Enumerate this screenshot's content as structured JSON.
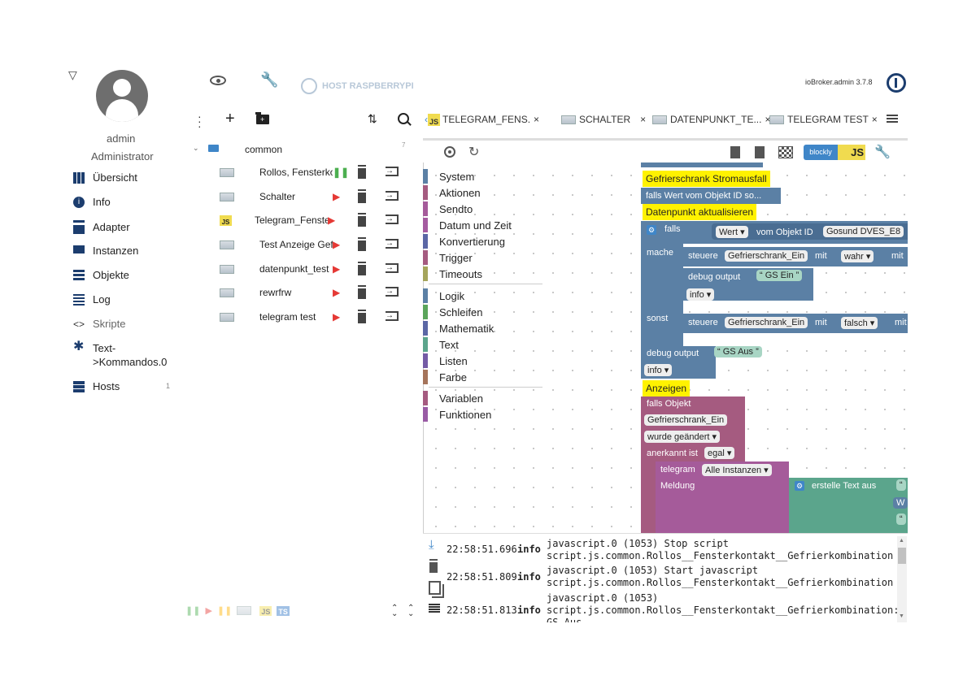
{
  "user": {
    "name": "admin",
    "role": "Administrator"
  },
  "nav": [
    {
      "label": "Übersicht",
      "icon": "grid-icon"
    },
    {
      "label": "Info",
      "icon": "info-icon"
    },
    {
      "label": "Adapter",
      "icon": "store-icon"
    },
    {
      "label": "Instanzen",
      "icon": "instances-icon"
    },
    {
      "label": "Objekte",
      "icon": "list-icon"
    },
    {
      "label": "Log",
      "icon": "log-icon"
    },
    {
      "label": "Skripte",
      "icon": "code-icon"
    },
    {
      "label": "Text-\n>Kommandos.0",
      "icon": "snowflake-icon"
    },
    {
      "label": "Hosts",
      "icon": "hosts-icon",
      "badge": "1"
    }
  ],
  "header": {
    "host": "HOST RASPBERRYPI",
    "version": "ioBroker.admin 3.7.8"
  },
  "tree": {
    "folder": "common",
    "count": "7",
    "items": [
      "Rollos, Fensterkontakt, Gefrierkombination",
      "Schalter",
      "Telegram_Fenster",
      "Test Anzeige Gefrierschrank",
      "datenpunkt_test",
      "rewrfrw",
      "telegram test"
    ]
  },
  "tabs": [
    "TELEGRAM_FENS.",
    "SCHALTER",
    "DATENPUNKT_TE...",
    "TELEGRAM TEST"
  ],
  "editor": {
    "blockly_label": "blockly",
    "js_label": "JS"
  },
  "categories": [
    {
      "label": "System",
      "color": "#5b80a5"
    },
    {
      "label": "Aktionen",
      "color": "#a55b80"
    },
    {
      "label": "Sendto",
      "color": "#a55b9a"
    },
    {
      "label": "Datum und Zeit",
      "color": "#a55ba0"
    },
    {
      "label": "Konvertierung",
      "color": "#5b67a5"
    },
    {
      "label": "Trigger",
      "color": "#a55b80"
    },
    {
      "label": "Timeouts",
      "color": "#a5a55b"
    },
    {
      "label": "Logik",
      "color": "#5b80a5"
    },
    {
      "label": "Schleifen",
      "color": "#5ba55b"
    },
    {
      "label": "Mathematik",
      "color": "#5b67a5"
    },
    {
      "label": "Text",
      "color": "#5ba58c"
    },
    {
      "label": "Listen",
      "color": "#745ba5"
    },
    {
      "label": "Farbe",
      "color": "#a5745b"
    },
    {
      "label": "Variablen",
      "color": "#a55b80"
    },
    {
      "label": "Funktionen",
      "color": "#995ba5"
    }
  ],
  "blocks": {
    "comment1": "Gefrierschrank Stromausfall",
    "trigger_text": "falls Wert vom Objekt ID so...",
    "comment2": "Datenpunkt aktualisieren",
    "if_label": "falls",
    "wert": "Wert",
    "vom_objekt": "vom Objekt ID",
    "gosund": "Gosund DVES_E8",
    "mache": "mache",
    "steuere1": "steuere",
    "gefr_ein1": "Gefrierschrank_Ein",
    "mit1": "mit",
    "wahr": "wahr",
    "mit1b": "mit",
    "debug1": "debug output",
    "gs_ein": "GS Ein",
    "info1": "info",
    "sonst": "sonst",
    "steuere2": "steuere",
    "gefr_ein2": "Gefrierschrank_Ein",
    "mit2": "mit",
    "falsch": "falsch",
    "mit2b": "mit",
    "debug2": "debug output",
    "gs_aus": "GS Aus",
    "info2": "info",
    "comment3": "Anzeigen",
    "falls_objekt": "falls Objekt",
    "gefr_ein3": "Gefrierschrank_Ein",
    "wurde_geaendert": "wurde geändert",
    "anerkannt": "anerkannt ist",
    "egal": "egal",
    "telegram": "telegram",
    "alle_instanzen": "Alle Instanzen",
    "meldung": "Meldung",
    "erstelle": "erstelle Text aus",
    "w": "W"
  },
  "log": [
    {
      "time": "22:58:51.696",
      "level": "info",
      "msg1": "javascript.0 (1053) Stop script",
      "msg2": "script.js.common.Rollos__Fensterkontakt__Gefrierkombination"
    },
    {
      "time": "22:58:51.809",
      "level": "info",
      "msg1": "javascript.0 (1053) Start javascript",
      "msg2": "script.js.common.Rollos__Fensterkontakt__Gefrierkombination"
    },
    {
      "time": "22:58:51.813",
      "level": "info",
      "msg1": "javascript.0 (1053)",
      "msg2": "script.js.common.Rollos__Fensterkontakt__Gefrierkombination:",
      "msg3": "GS Aus"
    }
  ],
  "footer": {
    "js": "JS",
    "ts": "TS"
  }
}
